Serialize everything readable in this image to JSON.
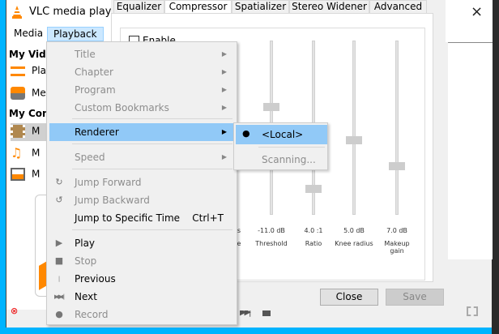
{
  "window": {
    "title": "VLC media playe",
    "close_icon": "×"
  },
  "menubar": {
    "media": "Media",
    "playback": "Playback"
  },
  "sidebar": {
    "my_videos_header": "My Videos",
    "playlist": "Pla",
    "media_library": "Me",
    "my_computer_header": "My Comp",
    "videos": "M",
    "music": "M",
    "pictures": "M"
  },
  "dialog": {
    "tabs": [
      "Equalizer",
      "Compressor",
      "Spatializer",
      "Stereo Widener",
      "Advanced"
    ],
    "active_tab": "Compressor",
    "enable_label": "Enable",
    "enabled": false,
    "sliders": [
      {
        "value": "",
        "label": "",
        "partial_value": "s",
        "partial_label": "e"
      },
      {
        "value": "-11.0 dB",
        "label": "Threshold",
        "level": 0.38
      },
      {
        "value": "4.0 :1",
        "label": "Ratio",
        "level": 0.85
      },
      {
        "value": "5.0 dB",
        "label": "Knee radius",
        "level": 0.57
      },
      {
        "value": "7.0 dB",
        "label": "Makeup gain",
        "level": 0.72
      }
    ],
    "close_label": "Close",
    "save_label": "Save"
  },
  "playback_menu": {
    "items": [
      {
        "label": "Title",
        "disabled": true,
        "submenu": true
      },
      {
        "label": "Chapter",
        "disabled": true,
        "submenu": true
      },
      {
        "label": "Program",
        "disabled": true,
        "submenu": true
      },
      {
        "label": "Custom Bookmarks",
        "disabled": true,
        "submenu": true
      },
      {
        "label": "Renderer",
        "disabled": false,
        "submenu": true,
        "highlighted": true
      },
      {
        "label": "Speed",
        "disabled": true,
        "submenu": true
      },
      {
        "label": "Jump Forward",
        "disabled": true
      },
      {
        "label": "Jump Backward",
        "disabled": true
      },
      {
        "label": "Jump to Specific Time",
        "shortcut": "Ctrl+T"
      },
      {
        "label": "Play"
      },
      {
        "label": "Stop",
        "disabled": true
      },
      {
        "label": "Previous"
      },
      {
        "label": "Next"
      },
      {
        "label": "Record",
        "disabled": true
      }
    ]
  },
  "renderer_submenu": {
    "local": "<Local>",
    "scanning": "Scanning..."
  },
  "colors": {
    "highlight": "#91c9f7",
    "accent": "#ff8800",
    "desktop": "#00b4ff"
  }
}
